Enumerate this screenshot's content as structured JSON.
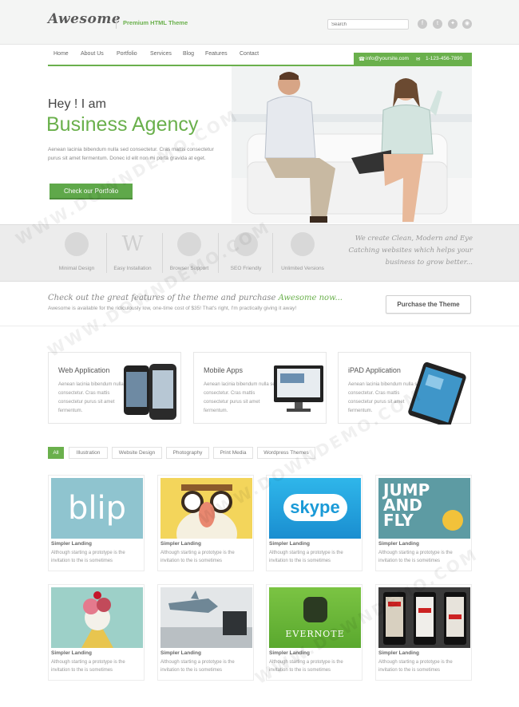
{
  "header": {
    "logo": "Awesome",
    "tagline": "Premium HTML Theme",
    "search_placeholder": "Search",
    "social": [
      "f-icon",
      "t-icon",
      "twitter-icon",
      "rss-icon"
    ]
  },
  "nav": {
    "items": [
      "Home",
      "About Us",
      "Portfolio",
      "Services",
      "Blog",
      "Features",
      "Contact"
    ],
    "email": "info@yoursite.com",
    "phone": "1-123-456-7890"
  },
  "hero": {
    "greeting": "Hey ! I am",
    "title": "Business Agency",
    "text": "Aenean lacinia bibendum nulla sed consectetur. Cras mattis consectetur purus sit amet fermentum. Donec id elit non mi porta gravida at eget.",
    "button": "Check our Portfolio"
  },
  "features": {
    "items": [
      {
        "label": "Minimal Design",
        "icon": "leaf-icon"
      },
      {
        "label": "Easy Installation",
        "icon": "wordpress-icon"
      },
      {
        "label": "Browser Support",
        "icon": "globe-icon"
      },
      {
        "label": "SEO Friendly",
        "icon": "gear-icon"
      },
      {
        "label": "Unlimited Versions",
        "icon": "plant-icon"
      }
    ],
    "quote": "We create Clean, Modern and Eye Catching websites which helps your business to grow better..."
  },
  "promo": {
    "title_part1": "Check out the great features of the theme and purchase ",
    "title_accent": "Awesome now...",
    "subtitle": "Awesome is available for the ridiculously low, one-time cost of $35! That's right, I'm practically giving it away!",
    "button": "Purchase the Theme"
  },
  "services": [
    {
      "title": "Web Application",
      "text": "Aenean lacinia bibendum nulla sed consectetur. Cras mattis consectetur purus sit amet fermentum."
    },
    {
      "title": "Mobile Apps",
      "text": "Aenean lacinia bibendum nulla sed consectetur. Cras mattis consectetur purus sit amet fermentum."
    },
    {
      "title": "iPAD Application",
      "text": "Aenean lacinia bibendum nulla sed consectetur. Cras mattis consectetur purus sit amet fermentum."
    }
  ],
  "filters": [
    "All",
    "Illustration",
    "Website Design",
    "Photography",
    "Print Media",
    "Wordpress Themes"
  ],
  "portfolio": {
    "items": [
      {
        "title": "Simpler Landing",
        "text": "Although starting a prototype is the invitation to the is sometimes",
        "image_text": "blip"
      },
      {
        "title": "Simpler Landing",
        "text": "Although starting a prototype is the invitation to the is sometimes",
        "image_text": ""
      },
      {
        "title": "Simpler Landing",
        "text": "Although starting a prototype is the invitation to the is sometimes",
        "image_text": "skype"
      },
      {
        "title": "Simpler Landing",
        "text": "Although starting a prototype is the invitation to the is sometimes",
        "image_text": "JUMP AND FLY"
      },
      {
        "title": "Simpler Landing",
        "text": "Although starting a prototype is the invitation to the is sometimes",
        "image_text": ""
      },
      {
        "title": "Simpler Landing",
        "text": "Although starting a prototype is the invitation to the is sometimes",
        "image_text": ""
      },
      {
        "title": "Simpler Landing",
        "text": "Although starting a prototype is the invitation to the is sometimes",
        "image_text": "EVERNOTE"
      },
      {
        "title": "Simpler Landing",
        "text": "Although starting a prototype is the invitation to the is sometimes",
        "image_text": ""
      }
    ]
  },
  "watermark": "WWW.DOWNDEMO.COM",
  "colors": {
    "accent": "#6ab04c",
    "text": "#555555"
  }
}
